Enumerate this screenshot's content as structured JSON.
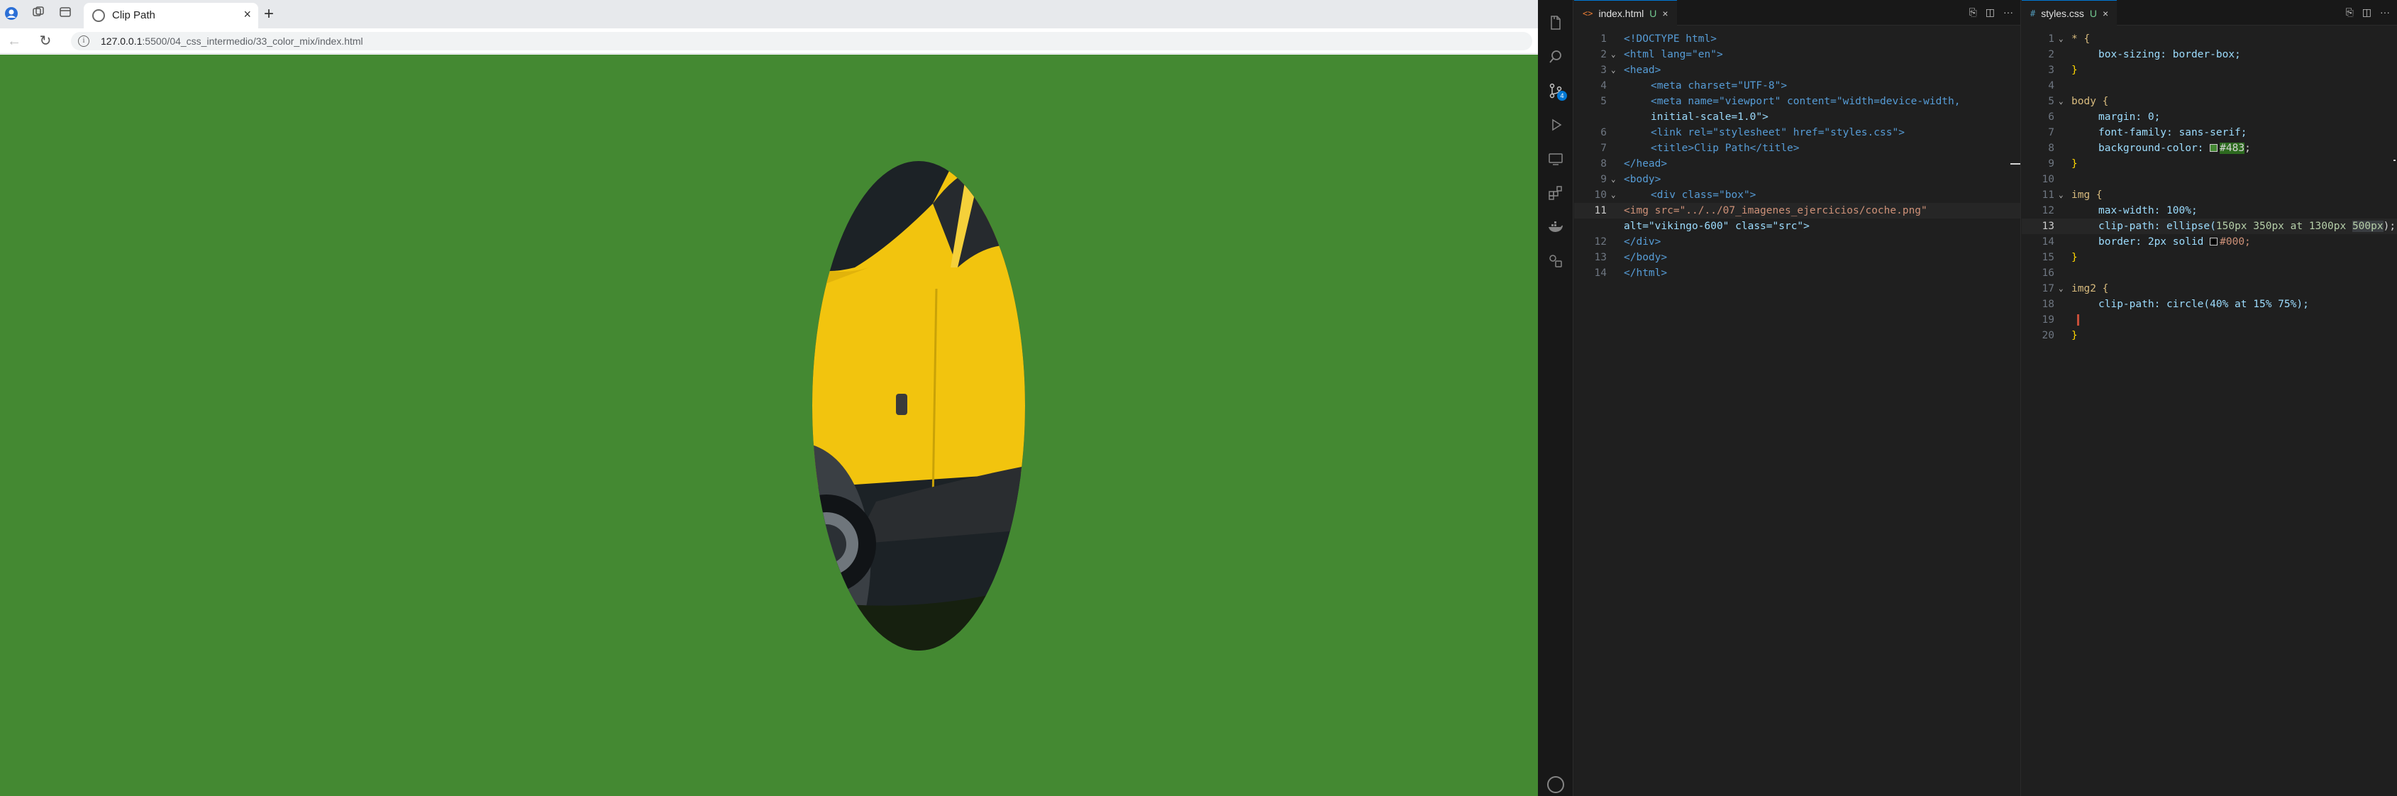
{
  "browser": {
    "tab_title": "Clip Path",
    "new_tab": "+",
    "close_glyph": "×",
    "url_host": "127.0.0.1",
    "url_path": ":5500/04_css_intermedio/33_color_mix/index.html",
    "page_background": "#448932"
  },
  "vscode": {
    "html_tab": {
      "icon": "<>",
      "name": "index.html",
      "status": "U",
      "close": "×"
    },
    "css_tab": {
      "icon": "#",
      "name": "styles.css",
      "status": "U",
      "close": "×"
    },
    "html_lines": [
      {
        "n": "1"
      },
      {
        "n": "2"
      },
      {
        "n": "3"
      },
      {
        "n": "4"
      },
      {
        "n": "5"
      },
      {
        "n": ""
      },
      {
        "n": "6"
      },
      {
        "n": "7"
      },
      {
        "n": "8"
      },
      {
        "n": "9"
      },
      {
        "n": "10"
      },
      {
        "n": "11"
      },
      {
        "n": ""
      },
      {
        "n": "12"
      },
      {
        "n": "13"
      },
      {
        "n": "14"
      }
    ],
    "css_lines": [
      {
        "n": "1"
      },
      {
        "n": "2"
      },
      {
        "n": "3"
      },
      {
        "n": "4"
      },
      {
        "n": "5"
      },
      {
        "n": "6"
      },
      {
        "n": "7"
      },
      {
        "n": "8"
      },
      {
        "n": "9"
      },
      {
        "n": "10"
      },
      {
        "n": "11"
      },
      {
        "n": "12"
      },
      {
        "n": "13"
      },
      {
        "n": "14"
      },
      {
        "n": "15"
      },
      {
        "n": "16"
      },
      {
        "n": "17"
      },
      {
        "n": "18"
      },
      {
        "n": "19"
      },
      {
        "n": "20"
      }
    ],
    "html_code": {
      "l1_doctype": "<!DOCTYPE html>",
      "l2": "<html lang=\"en\">",
      "l3": "<head>",
      "l4": "<meta charset=\"UTF-8\">",
      "l5a": "<meta name=\"viewport\" content=\"width=device-width,",
      "l5b": "initial-scale=1.0\">",
      "l6": "<link rel=\"stylesheet\" href=\"styles.css\">",
      "l7": "<title>Clip Path</title>",
      "l8": "</head>",
      "l9": "<body>",
      "l10": "<div class=\"box\">",
      "l11a": "<img src=\"../../07_imagenes_ejercicios/coche.png\"",
      "l11b": "alt=\"vikingo-600\" class=\"src\">",
      "l12": "</div>",
      "l13": "</body>",
      "l14": "</html>"
    },
    "css_code": {
      "l1": "* {",
      "l2": "box-sizing: border-box;",
      "l3": "}",
      "l5": "body {",
      "l6": "margin: 0;",
      "l7": "font-family: sans-serif;",
      "l8_prop": "background-color: ",
      "l8_val": "#483",
      "l9": "}",
      "l11": "img {",
      "l12": "max-width: 100%;",
      "l13_a": "clip-path: ellipse(",
      "l13_b": "150px 350px at 1300px ",
      "l13_c": "500px",
      "l13_d": ");",
      "l14_a": "border: 2px solid ",
      "l14_b": "#000;",
      "l15": "}",
      "l17": "img2 {",
      "l18": "clip-path: circle(40% at 15% 75%);",
      "l20": "}"
    },
    "colors": {
      "swatch_green": "#448833",
      "swatch_black": "#000000",
      "accent": "#0078d4"
    }
  }
}
